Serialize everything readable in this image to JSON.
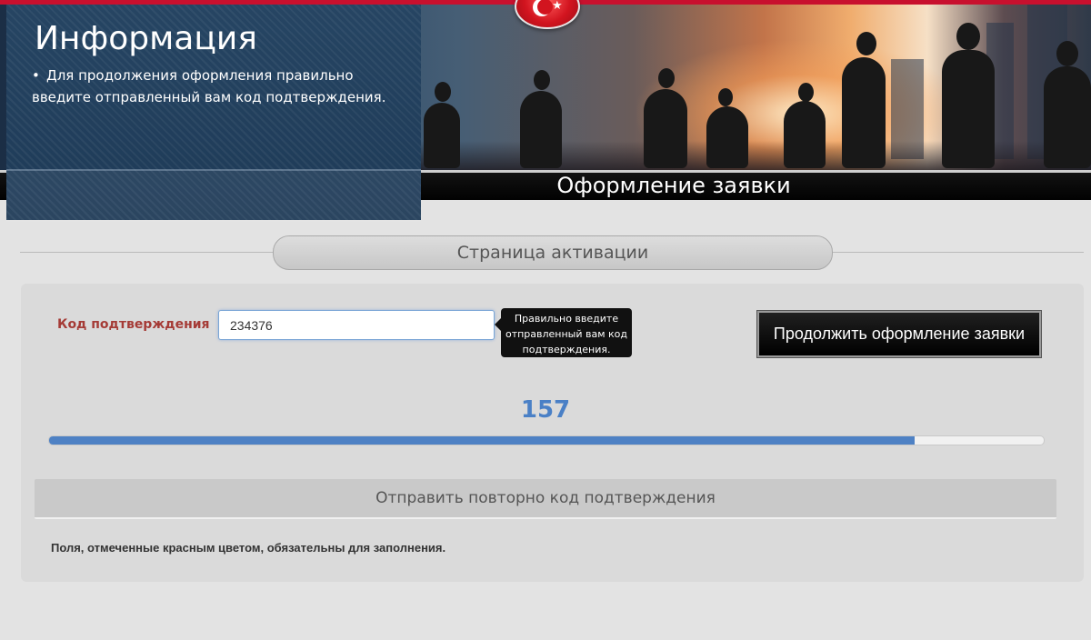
{
  "info": {
    "title": "Информация",
    "bullet": "Для продолжения оформления правильно введите отправленный вам код подтверждения."
  },
  "banner": {
    "app_title": "Оформление заявки"
  },
  "section": {
    "title": "Страница активации"
  },
  "form": {
    "code_label": "Код подтверждения",
    "code_value": "234376",
    "tooltip": "Правильно введите отправленный вам код подтверждения.",
    "continue_label": "Продолжить оформление заявки"
  },
  "timer": {
    "value": "157",
    "progress_fraction": 0.87
  },
  "resend_label": "Отправить повторно код подтверждения",
  "required_note": "Поля, отмеченные красным цветом, обязательны для заполнения.",
  "colors": {
    "accent_red": "#c8102e",
    "label_red": "#a53b36",
    "progress_blue": "#4e81c4"
  }
}
